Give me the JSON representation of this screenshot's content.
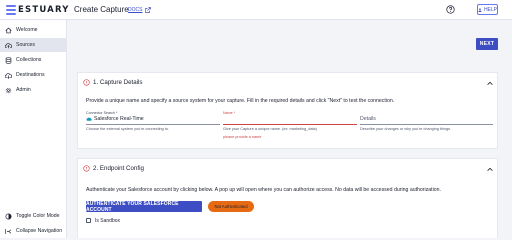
{
  "header": {
    "logo_text": "ESTUARY",
    "page_title": "Create Capture",
    "docs_link": "DOCS",
    "help_label": "HELP"
  },
  "sidebar": {
    "items": [
      {
        "label": "Welcome",
        "icon": "home-icon"
      },
      {
        "label": "Sources",
        "icon": "cloud-upload-icon"
      },
      {
        "label": "Collections",
        "icon": "database-icon"
      },
      {
        "label": "Destinations",
        "icon": "cloud-download-icon"
      },
      {
        "label": "Admin",
        "icon": "gear-icon"
      }
    ],
    "active_index": 1,
    "footer": [
      {
        "label": "Toggle Color Mode",
        "icon": "half-moon-icon"
      },
      {
        "label": "Collapse Navigation",
        "icon": "collapse-icon"
      }
    ]
  },
  "actions": {
    "next_label": "NEXT"
  },
  "capture_details": {
    "title": "1. Capture Details",
    "description": "Provide a unique name and specify a source system for your capture. Fill in the required details and click \"Next\" to test the connection.",
    "connector": {
      "label": "Connector Search *",
      "value": "Salesforce Real-Time",
      "helper": "Choose the external system you're connecting to."
    },
    "name": {
      "label": "Name *",
      "value": "",
      "helper": "Give your Capture a unique name. (ex: marketing_data)",
      "error": "please provide a name"
    },
    "details": {
      "placeholder": "Details",
      "helper": "Describe your changes or why you're changing things."
    }
  },
  "endpoint_config": {
    "title": "2. Endpoint Config",
    "description": "Authenticate your Salesforce account by clicking below. A pop up will open where you can authorize access. No data will be accessed during authorization.",
    "auth_button": "AUTHENTICATE YOUR SALESFORCE ACCOUNT",
    "auth_status": "Not Authenticated",
    "sandbox_label": "Is Sandbox",
    "sandbox_checked": false
  },
  "colors": {
    "primary": "#3d4ec4",
    "error": "#d04343",
    "badge": "#e66a14"
  }
}
